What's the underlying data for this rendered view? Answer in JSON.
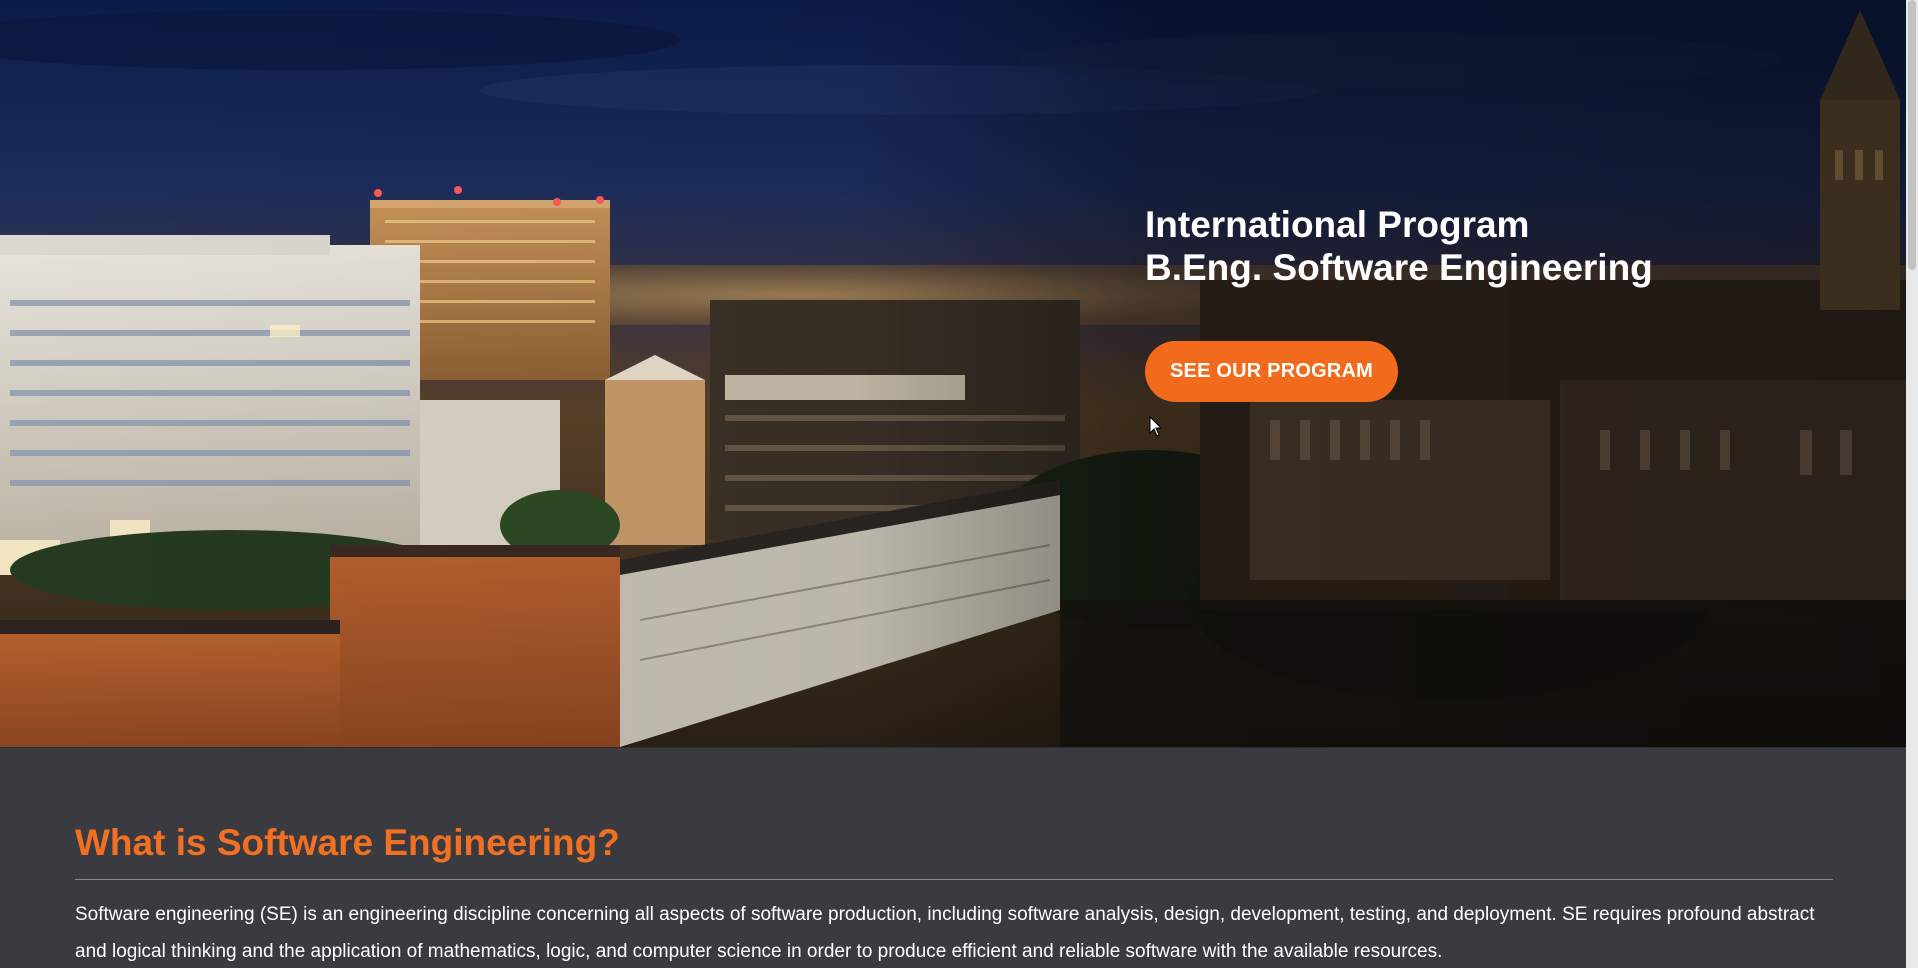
{
  "hero": {
    "title_line1": "International Program",
    "title_line2": "B.Eng. Software Engineering",
    "cta_label": "SEE OUR PROGRAM",
    "cta_color": "#f26b1d"
  },
  "section": {
    "heading": "What is Software Engineering?",
    "heading_color": "#f27022",
    "body": "Software engineering (SE) is an engineering discipline concerning all aspects of software production, including software analysis, design, development, testing, and deployment. SE requires profound abstract and logical thinking and the application of mathematics, logic, and computer science in order to produce efficient and reliable software with the available resources."
  },
  "icons": {
    "cursor": "mouse-pointer-icon"
  }
}
